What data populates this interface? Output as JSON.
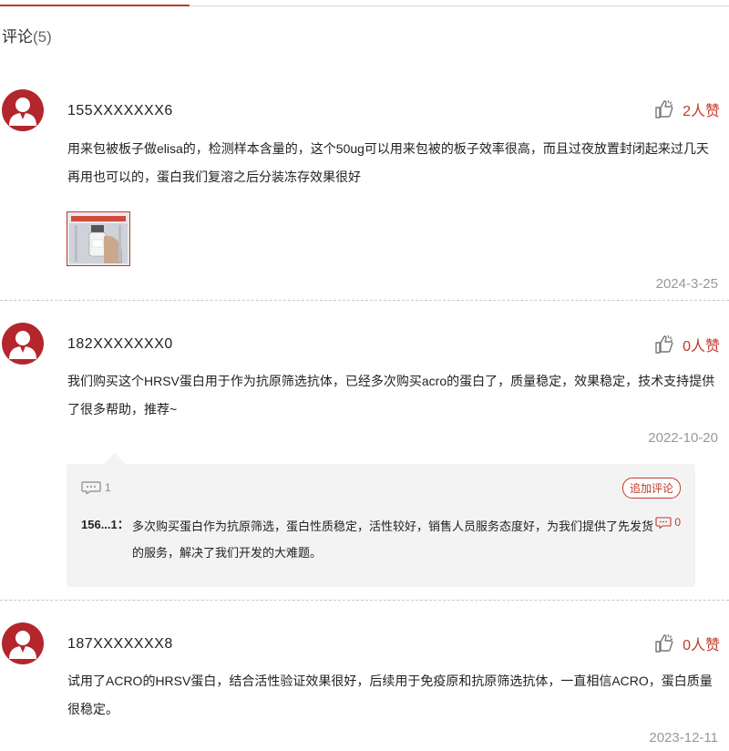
{
  "section": {
    "title": "评论",
    "count": "(5)"
  },
  "reviews": [
    {
      "user": "155XXXXXXX6",
      "likes": "2人赞",
      "text": "用来包被板子做elisa的，检测样本含量的，这个50ug可以用来包被的板子效率很高，而且过夜放置封闭起来过几天再用也可以的，蛋白我们复溶之后分装冻存效果很好",
      "date": "2024-3-25"
    },
    {
      "user": "182XXXXXXX0",
      "likes": "0人赞",
      "text": "我们购买这个HRSV蛋白用于作为抗原筛选抗体，已经多次购买acro的蛋白了，质量稳定，效果稳定，技术支持提供了很多帮助，推荐~",
      "date": "2022-10-20",
      "reply_block": {
        "reply_count": "1",
        "add_comment_label": "追加评论",
        "reply": {
          "user": "156...1：",
          "text": "多次购买蛋白作为抗原筛选，蛋白性质稳定，活性较好，销售人员服务态度好，为我们提供了先发货的服务，解决了我们开发的大难题。",
          "sub_count": "0"
        }
      }
    },
    {
      "user": "187XXXXXXX8",
      "likes": "0人赞",
      "text": "试用了ACRO的HRSV蛋白，结合活性验证效果很好，后续用于免疫原和抗原筛选抗体，一直相信ACRO，蛋白质量很稳定。",
      "date": "2023-12-11"
    }
  ],
  "icons": {
    "avatar": "user-avatar-icon",
    "like": "thumbs-up-icon",
    "comment": "comment-bubble-icon"
  },
  "colors": {
    "accent": "#c0392b",
    "avatar_bg": "#b3262c",
    "muted": "#999999",
    "reply_bg": "#f3f3f3"
  }
}
